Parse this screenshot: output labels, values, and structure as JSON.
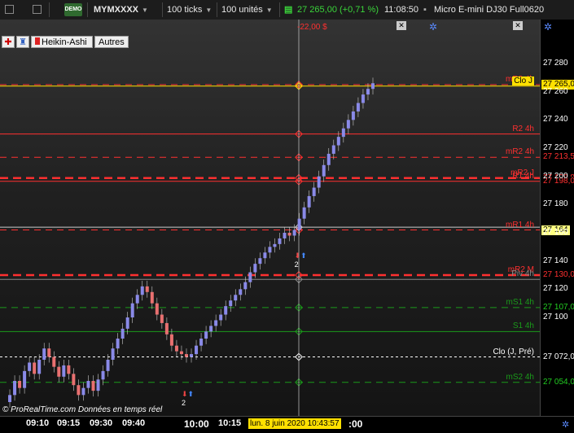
{
  "toolbar": {
    "symbol": "MYMXXXX",
    "demo": "DEMO",
    "interval": "100 ticks",
    "units": "100 unités",
    "last_price": "27 265,00 (+0,71 %)",
    "time": "11:08:50",
    "instrument": "Micro E-mini DJ30 Full0620"
  },
  "tabs": {
    "heikin": "Heikin-Ashi",
    "other": "Autres"
  },
  "pnl": "-22,00 $",
  "footer": {
    "logo": "© ProRealTime.com",
    "text": "Données en temps réel"
  },
  "price_ticks": [
    "27 280",
    "27 260",
    "27 240",
    "27 220",
    "27 200",
    "27 180",
    "27 160",
    "27 140",
    "27 120",
    "27 100"
  ],
  "price_tick_values": [
    27280,
    27260,
    27240,
    27220,
    27200,
    27180,
    27160,
    27140,
    27120,
    27100
  ],
  "x_ticks": [
    "09:10",
    "09:15",
    "09:30",
    "09:40",
    "10:00",
    "10:15",
    ":00"
  ],
  "cursor_label": "lun. 8 juin 2020 10:43:57",
  "levels": [
    {
      "name": "mR3 4h",
      "value": 27265.0,
      "color": "#ff3030",
      "style": "dashed",
      "badge": "27 265,0",
      "badge_bg": "#ffe000",
      "badge_fg": "#000"
    },
    {
      "name": "Clo J",
      "value": 27264,
      "color": "#ffe000",
      "style": "solid",
      "badge": "",
      "badge_bg": "",
      "badge_fg": ""
    },
    {
      "name": "R2 4h",
      "value": 27230,
      "color": "#ff3030",
      "style": "solid",
      "badge": "",
      "badge_bg": "",
      "badge_fg": ""
    },
    {
      "name": "mR2 4h",
      "value": 27213.5,
      "color": "#ff3030",
      "style": "dashed",
      "badge": "27 213,5",
      "badge_bg": "#000",
      "badge_fg": "#ff3030"
    },
    {
      "name": "mR2 J",
      "value": 27198.8,
      "color": "#ff3030",
      "style": "bold-dashed",
      "badge": "27 198,8",
      "badge_bg": "#000",
      "badge_fg": "#ff3030"
    },
    {
      "name": "R1 4h",
      "value": 27196.5,
      "color": "#ff3030",
      "style": "solid",
      "badge": "27 198,0",
      "badge_bg": "#000",
      "badge_fg": "#ff3030"
    },
    {
      "name": "mR1 4h",
      "value": 27162,
      "color": "#ff3030",
      "style": "dashed",
      "badge": "27 164",
      "badge_bg": "#ffff80",
      "badge_fg": "#000"
    },
    {
      "name": "",
      "value": 27164,
      "color": "#cccccc",
      "style": "solid",
      "badge": "",
      "badge_bg": "",
      "badge_fg": ""
    },
    {
      "name": "mR2 M",
      "value": 27130,
      "color": "#ff3030",
      "style": "bold-dashed",
      "badge": "27 130,0",
      "badge_bg": "#000",
      "badge_fg": "#ff3030"
    },
    {
      "name": "Piv 4h",
      "value": 27127,
      "color": "#888888",
      "style": "solid",
      "badge": "",
      "badge_bg": "",
      "badge_fg": ""
    },
    {
      "name": "mS1 4h",
      "value": 27107,
      "color": "#1a9a1a",
      "style": "dashed",
      "badge": "27 107,0",
      "badge_bg": "#000",
      "badge_fg": "#22cc22"
    },
    {
      "name": "S1 4h",
      "value": 27090,
      "color": "#1a9a1a",
      "style": "solid",
      "badge": "",
      "badge_bg": "",
      "badge_fg": ""
    },
    {
      "name": "Clo (J, Pré)",
      "value": 27072,
      "color": "#ffffff",
      "style": "dotted",
      "badge": "27 072,0",
      "badge_bg": "#000",
      "badge_fg": "#fff"
    },
    {
      "name": "mS2 4h",
      "value": 27054,
      "color": "#1a9a1a",
      "style": "dashed",
      "badge": "27 054,0",
      "badge_bg": "#000",
      "badge_fg": "#22cc22"
    }
  ],
  "colors": {
    "up": "#8a8ae8",
    "down": "#e87070",
    "wick": "#cccccc",
    "cursor": "#cccccc"
  },
  "markers": [
    {
      "count": "2",
      "time_index": 37
    },
    {
      "count": "2",
      "time_index": 60
    }
  ]
}
